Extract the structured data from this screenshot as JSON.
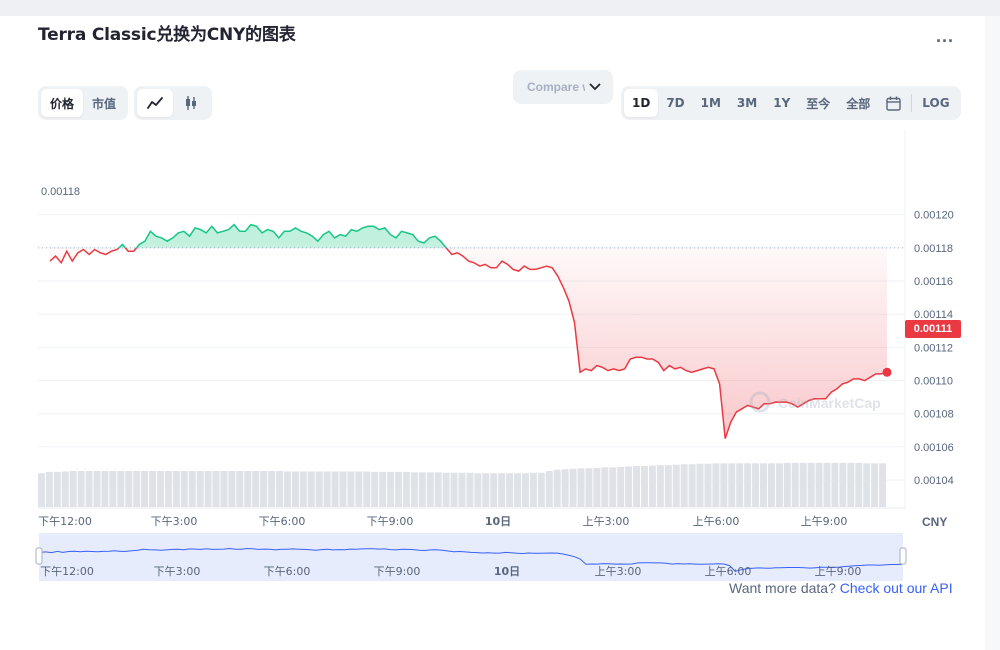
{
  "header": {
    "title": "Terra Classic兑换为CNY的图表",
    "more": "..."
  },
  "toggle_metric": {
    "items": [
      "价格",
      "市值"
    ],
    "active": 0
  },
  "toggle_chart_type": {
    "items": [
      "line-chart-icon",
      "candlestick-icon"
    ],
    "active": 0
  },
  "compare": {
    "label": "Compare with"
  },
  "range": {
    "items": [
      "1D",
      "7D",
      "1M",
      "3M",
      "1Y",
      "至今",
      "全部"
    ],
    "active": 0,
    "calendar_icon": "calendar-icon",
    "log_label": "LOG"
  },
  "footer": {
    "text": "Want more data?",
    "link": "Check out our API"
  },
  "watermark": "CoinMarketCap",
  "colors": {
    "up": "#16c784",
    "down": "#ea3943",
    "link": "#3861fb",
    "nav_line": "#3861fb"
  },
  "chart_data": {
    "type": "line",
    "currency_label": "CNY",
    "y_ticks": [
      "0.00120",
      "0.00118",
      "0.00116",
      "0.00114",
      "0.00112",
      "0.00110",
      "0.00108",
      "0.00106",
      "0.00104"
    ],
    "ylim": [
      0.001028,
      0.001242
    ],
    "x_labels": [
      "下午12:00",
      "下午3:00",
      "下午6:00",
      "下午9:00",
      "10日",
      "上午3:00",
      "上午6:00",
      "上午9:00"
    ],
    "reference_value": "0.00118",
    "current_value": "0.00111",
    "series": [
      {
        "values": [
          0.001172,
          0.001175,
          0.001171,
          0.001178,
          0.001172,
          0.001177,
          0.001179,
          0.001176,
          0.001179,
          0.001177,
          0.001176,
          0.001178,
          0.001179,
          0.001182,
          0.001178,
          0.001178,
          0.001182,
          0.001184,
          0.00119,
          0.001187,
          0.001186,
          0.001184,
          0.001186,
          0.001189,
          0.00119,
          0.001187,
          0.001192,
          0.001191,
          0.001189,
          0.001193,
          0.001189,
          0.00119,
          0.001191,
          0.001194,
          0.00119,
          0.00119,
          0.001194,
          0.001193,
          0.001189,
          0.001191,
          0.00119,
          0.001186,
          0.00119,
          0.00119,
          0.001192,
          0.00119,
          0.001189,
          0.001187,
          0.001184,
          0.001188,
          0.00119,
          0.001186,
          0.001188,
          0.001187,
          0.001191,
          0.00119,
          0.001192,
          0.001193,
          0.001193,
          0.001191,
          0.001192,
          0.001188,
          0.001186,
          0.00119,
          0.001189,
          0.001188,
          0.001184,
          0.001183,
          0.001186,
          0.001187,
          0.001184,
          0.00118,
          0.001176,
          0.001177,
          0.001175,
          0.001172,
          0.001171,
          0.001169,
          0.00117,
          0.001168,
          0.001168,
          0.001172,
          0.00117,
          0.001167,
          0.001166,
          0.001169,
          0.001167,
          0.001167,
          0.001168,
          0.001169,
          0.001168,
          0.001163,
          0.001156,
          0.001148,
          0.001135,
          0.001105,
          0.001107,
          0.001106,
          0.001109,
          0.001108,
          0.001106,
          0.001107,
          0.001106,
          0.001107,
          0.001113,
          0.001114,
          0.001114,
          0.001113,
          0.001113,
          0.001111,
          0.001106,
          0.001109,
          0.001107,
          0.001108,
          0.001106,
          0.001105,
          0.001106,
          0.001107,
          0.001108,
          0.001107,
          0.001098,
          0.001065,
          0.001075,
          0.001081,
          0.001083,
          0.001085,
          0.001084,
          0.001083,
          0.001086,
          0.001086,
          0.001087,
          0.001087,
          0.001087,
          0.001086,
          0.001084,
          0.001086,
          0.001088,
          0.001089,
          0.001089,
          0.001089,
          0.001093,
          0.001095,
          0.001098,
          0.001099,
          0.001101,
          0.001101,
          0.0011,
          0.001102,
          0.001104,
          0.001104,
          0.001105
        ]
      }
    ],
    "volume": [
      0.75,
      0.78,
      0.78,
      0.79,
      0.8,
      0.8,
      0.8,
      0.8,
      0.8,
      0.8,
      0.8,
      0.8,
      0.8,
      0.8,
      0.8,
      0.8,
      0.8,
      0.8,
      0.8,
      0.8,
      0.8,
      0.8,
      0.8,
      0.8,
      0.8,
      0.8,
      0.8,
      0.8,
      0.8,
      0.8,
      0.8,
      0.79,
      0.79,
      0.79,
      0.79,
      0.79,
      0.79,
      0.79,
      0.79,
      0.79,
      0.79,
      0.79,
      0.78,
      0.78,
      0.78,
      0.78,
      0.78,
      0.77,
      0.77,
      0.77,
      0.77,
      0.76,
      0.76,
      0.76,
      0.76,
      0.75,
      0.75,
      0.75,
      0.75,
      0.75,
      0.75,
      0.75,
      0.76,
      0.76,
      0.8,
      0.83,
      0.84,
      0.85,
      0.86,
      0.86,
      0.87,
      0.88,
      0.88,
      0.89,
      0.9,
      0.91,
      0.91,
      0.92,
      0.93,
      0.93,
      0.94,
      0.95,
      0.95,
      0.96,
      0.96,
      0.97,
      0.97,
      0.97,
      0.97,
      0.97,
      0.97,
      0.97,
      0.97,
      0.97,
      0.98,
      0.98,
      0.98,
      0.98,
      0.98,
      0.98,
      0.98,
      0.98,
      0.98,
      0.98,
      0.97,
      0.97,
      0.97
    ]
  }
}
